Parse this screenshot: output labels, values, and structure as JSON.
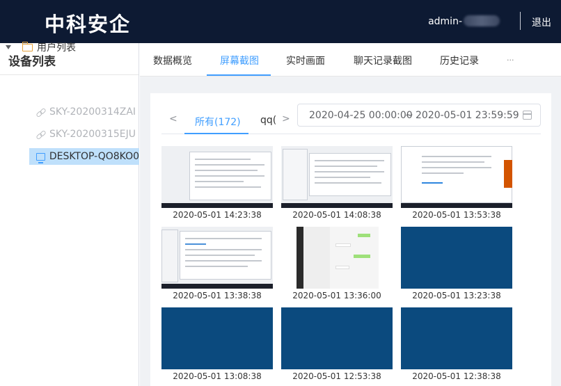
{
  "header": {
    "logo": "中科安企",
    "user": "admin-",
    "logout": "退出"
  },
  "sidebar": {
    "title": "设备列表",
    "root": "用户列表",
    "items": [
      {
        "label": "SKY-20200314ZAI",
        "status": "offline"
      },
      {
        "label": "SKY-20200315EJU",
        "status": "offline"
      },
      {
        "label": "DESKTOP-QO8KO0",
        "status": "online-selected"
      }
    ]
  },
  "nav": {
    "tabs": [
      "数据概览",
      "屏幕截图",
      "实时画面",
      "聊天记录截图",
      "历史记录",
      "···"
    ],
    "active": "屏幕截图"
  },
  "subtabs": {
    "tabs": [
      "所有(172)",
      "qq("
    ],
    "active": "所有(172)",
    "prev": "<",
    "next": ">"
  },
  "daterange": {
    "start": "2020-04-25 00:00:00",
    "sep": "~",
    "end": "2020-05-01 23:59:59"
  },
  "screenshots": [
    {
      "time": "2020-05-01 14:23:38",
      "kind": "document"
    },
    {
      "time": "2020-05-01 14:08:38",
      "kind": "document"
    },
    {
      "time": "2020-05-01 13:53:38",
      "kind": "document"
    },
    {
      "time": "2020-05-01 13:38:38",
      "kind": "document"
    },
    {
      "time": "2020-05-01 13:36:00",
      "kind": "chat"
    },
    {
      "time": "2020-05-01 13:23:38",
      "kind": "blank"
    },
    {
      "time": "2020-05-01 13:08:38",
      "kind": "blank"
    },
    {
      "time": "2020-05-01 12:53:38",
      "kind": "blank"
    },
    {
      "time": "2020-05-01 12:38:38",
      "kind": "blank"
    }
  ],
  "colors": {
    "header_bg": "#0d1a33",
    "accent": "#409eff",
    "blank_thumb": "#0b4a7e",
    "selected_bg": "#bfe0fb"
  }
}
